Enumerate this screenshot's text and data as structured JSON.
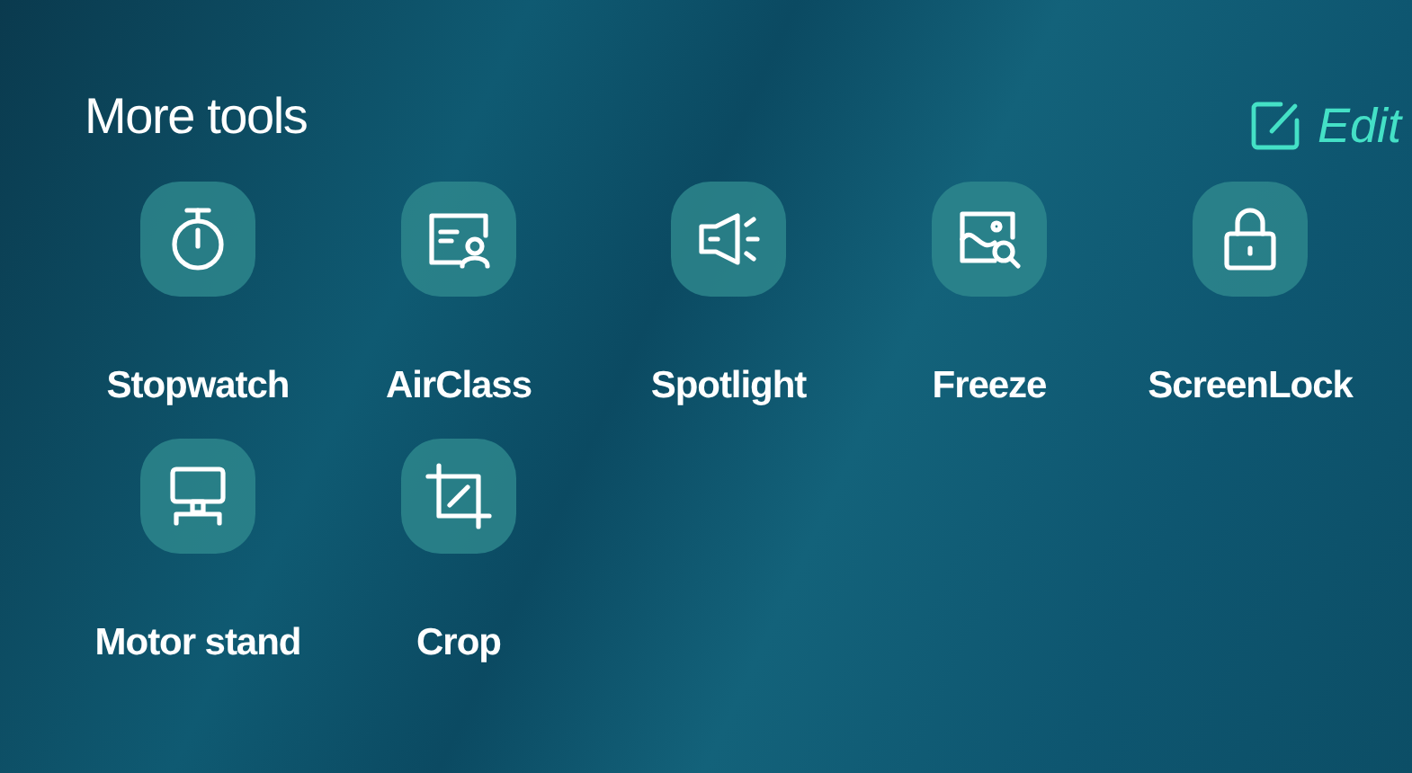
{
  "header": {
    "title": "More tools",
    "edit_label": "Edit"
  },
  "tools": [
    {
      "label": "Stopwatch",
      "kind": "stopwatch"
    },
    {
      "label": "AirClass",
      "kind": "airclass"
    },
    {
      "label": "Spotlight",
      "kind": "spotlight"
    },
    {
      "label": "Freeze",
      "kind": "freeze"
    },
    {
      "label": "ScreenLock",
      "kind": "lock"
    },
    {
      "label": "Motor stand",
      "kind": "stand"
    },
    {
      "label": "Crop",
      "kind": "crop"
    }
  ]
}
